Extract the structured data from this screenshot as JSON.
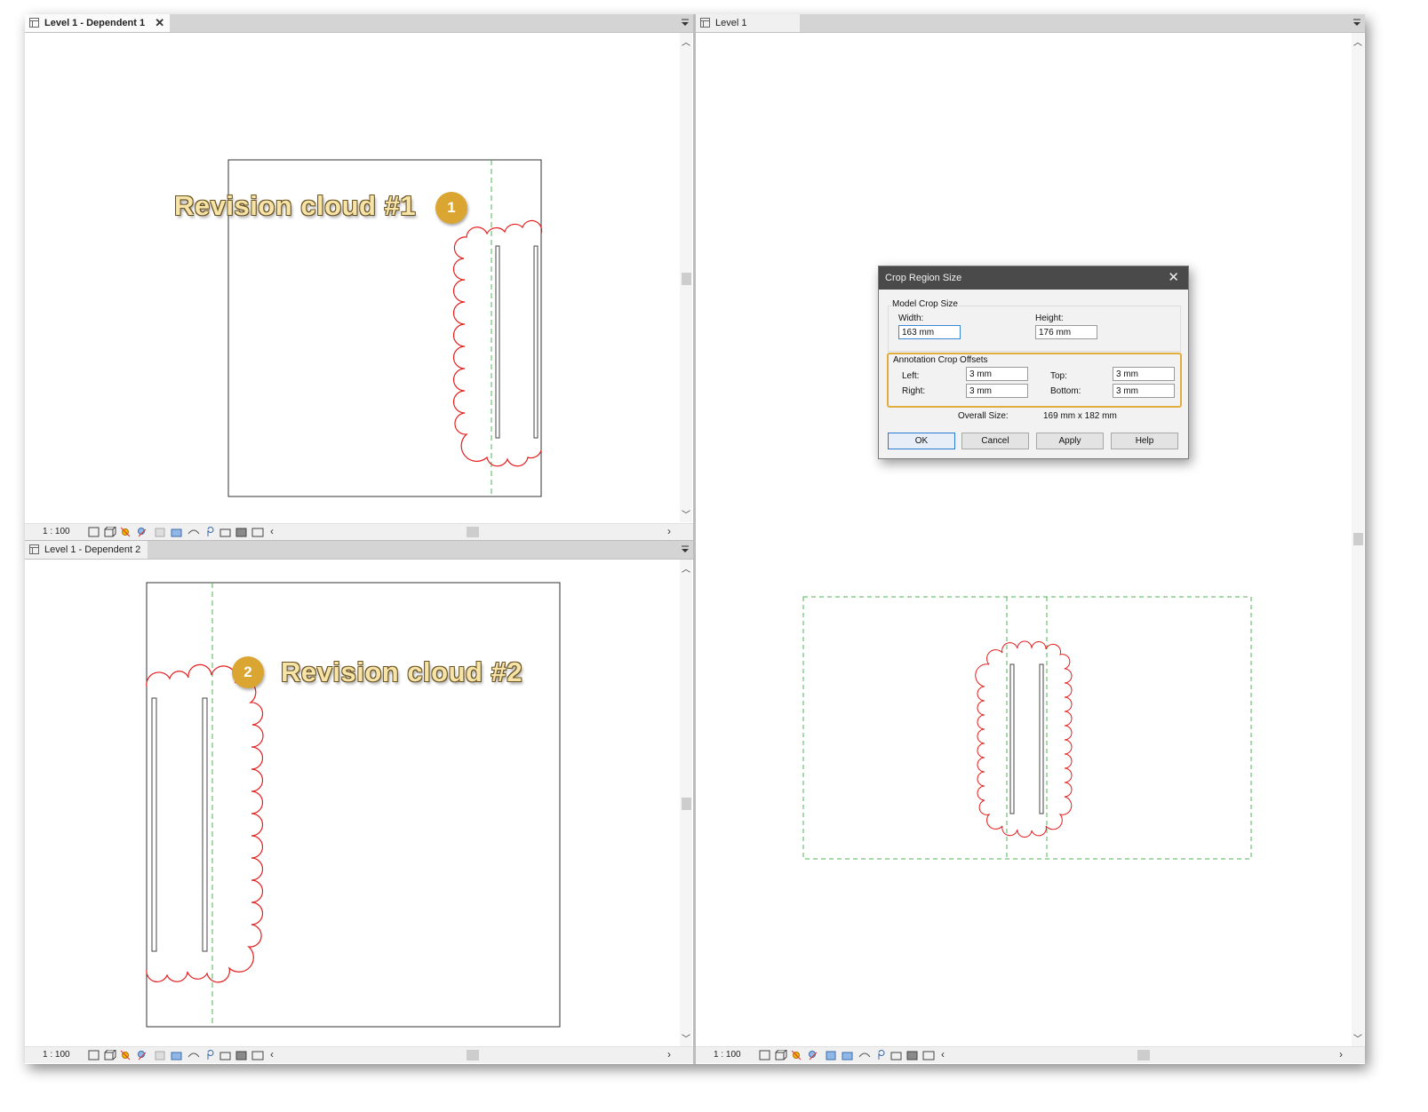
{
  "views": {
    "top_left": {
      "tab_label": "Level 1 - Dependent 1",
      "close_glyph": "✕",
      "scale": "1 : 100",
      "callout": "Revision cloud #1",
      "badge": "1"
    },
    "bottom_left": {
      "tab_label": "Level 1 - Dependent 2",
      "scale": "1 : 100",
      "callout": "Revision cloud #2",
      "badge": "2"
    },
    "right": {
      "tab_label": "Level 1",
      "scale": "1 : 100"
    }
  },
  "dialog": {
    "title": "Crop Region Size",
    "model_crop": {
      "group_title": "Model Crop Size",
      "width_label": "Width:",
      "width_value": "163 mm",
      "height_label": "Height:",
      "height_value": "176 mm"
    },
    "annotation_crop": {
      "group_title": "Annotation Crop Offsets",
      "left_label": "Left:",
      "left_value": "3 mm",
      "top_label": "Top:",
      "top_value": "3 mm",
      "right_label": "Right:",
      "right_value": "3 mm",
      "bottom_label": "Bottom:",
      "bottom_value": "3 mm"
    },
    "overall_label": "Overall Size:",
    "overall_value": "169 mm x 182 mm",
    "buttons": {
      "ok": "OK",
      "cancel": "Cancel",
      "apply": "Apply",
      "help": "Help"
    }
  },
  "colors": {
    "revision_cloud": "#e41e1e",
    "crop_dashed": "#52b352",
    "callout_accent": "#dba531"
  },
  "icons": {
    "view_tab": "view-tab-icon",
    "statusbar_tools": [
      "detail-level-icon",
      "visual-style-icon",
      "sun-path-icon",
      "shadows-icon",
      "render-icon",
      "crop-view-icon",
      "show-crop-icon",
      "temp-hide-icon",
      "reveal-hidden-icon",
      "temp-view-properties-icon",
      "analytical-model-icon",
      "highlight-displacement-icon"
    ]
  }
}
